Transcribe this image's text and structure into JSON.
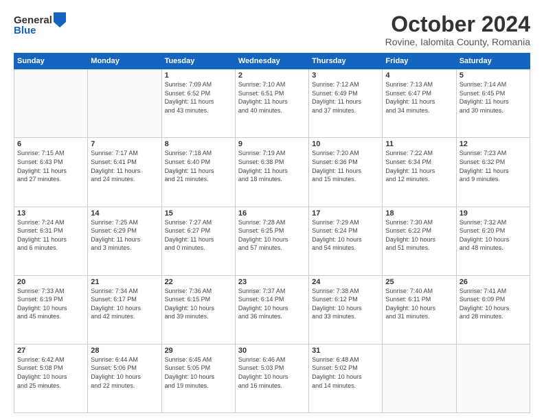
{
  "header": {
    "logo_general": "General",
    "logo_blue": "Blue",
    "title": "October 2024",
    "subtitle": "Rovine, Ialomita County, Romania"
  },
  "weekdays": [
    "Sunday",
    "Monday",
    "Tuesday",
    "Wednesday",
    "Thursday",
    "Friday",
    "Saturday"
  ],
  "weeks": [
    [
      {
        "day": "",
        "info": ""
      },
      {
        "day": "",
        "info": ""
      },
      {
        "day": "1",
        "info": "Sunrise: 7:09 AM\nSunset: 6:52 PM\nDaylight: 11 hours\nand 43 minutes."
      },
      {
        "day": "2",
        "info": "Sunrise: 7:10 AM\nSunset: 6:51 PM\nDaylight: 11 hours\nand 40 minutes."
      },
      {
        "day": "3",
        "info": "Sunrise: 7:12 AM\nSunset: 6:49 PM\nDaylight: 11 hours\nand 37 minutes."
      },
      {
        "day": "4",
        "info": "Sunrise: 7:13 AM\nSunset: 6:47 PM\nDaylight: 11 hours\nand 34 minutes."
      },
      {
        "day": "5",
        "info": "Sunrise: 7:14 AM\nSunset: 6:45 PM\nDaylight: 11 hours\nand 30 minutes."
      }
    ],
    [
      {
        "day": "6",
        "info": "Sunrise: 7:15 AM\nSunset: 6:43 PM\nDaylight: 11 hours\nand 27 minutes."
      },
      {
        "day": "7",
        "info": "Sunrise: 7:17 AM\nSunset: 6:41 PM\nDaylight: 11 hours\nand 24 minutes."
      },
      {
        "day": "8",
        "info": "Sunrise: 7:18 AM\nSunset: 6:40 PM\nDaylight: 11 hours\nand 21 minutes."
      },
      {
        "day": "9",
        "info": "Sunrise: 7:19 AM\nSunset: 6:38 PM\nDaylight: 11 hours\nand 18 minutes."
      },
      {
        "day": "10",
        "info": "Sunrise: 7:20 AM\nSunset: 6:36 PM\nDaylight: 11 hours\nand 15 minutes."
      },
      {
        "day": "11",
        "info": "Sunrise: 7:22 AM\nSunset: 6:34 PM\nDaylight: 11 hours\nand 12 minutes."
      },
      {
        "day": "12",
        "info": "Sunrise: 7:23 AM\nSunset: 6:32 PM\nDaylight: 11 hours\nand 9 minutes."
      }
    ],
    [
      {
        "day": "13",
        "info": "Sunrise: 7:24 AM\nSunset: 6:31 PM\nDaylight: 11 hours\nand 6 minutes."
      },
      {
        "day": "14",
        "info": "Sunrise: 7:25 AM\nSunset: 6:29 PM\nDaylight: 11 hours\nand 3 minutes."
      },
      {
        "day": "15",
        "info": "Sunrise: 7:27 AM\nSunset: 6:27 PM\nDaylight: 11 hours\nand 0 minutes."
      },
      {
        "day": "16",
        "info": "Sunrise: 7:28 AM\nSunset: 6:25 PM\nDaylight: 10 hours\nand 57 minutes."
      },
      {
        "day": "17",
        "info": "Sunrise: 7:29 AM\nSunset: 6:24 PM\nDaylight: 10 hours\nand 54 minutes."
      },
      {
        "day": "18",
        "info": "Sunrise: 7:30 AM\nSunset: 6:22 PM\nDaylight: 10 hours\nand 51 minutes."
      },
      {
        "day": "19",
        "info": "Sunrise: 7:32 AM\nSunset: 6:20 PM\nDaylight: 10 hours\nand 48 minutes."
      }
    ],
    [
      {
        "day": "20",
        "info": "Sunrise: 7:33 AM\nSunset: 6:19 PM\nDaylight: 10 hours\nand 45 minutes."
      },
      {
        "day": "21",
        "info": "Sunrise: 7:34 AM\nSunset: 6:17 PM\nDaylight: 10 hours\nand 42 minutes."
      },
      {
        "day": "22",
        "info": "Sunrise: 7:36 AM\nSunset: 6:15 PM\nDaylight: 10 hours\nand 39 minutes."
      },
      {
        "day": "23",
        "info": "Sunrise: 7:37 AM\nSunset: 6:14 PM\nDaylight: 10 hours\nand 36 minutes."
      },
      {
        "day": "24",
        "info": "Sunrise: 7:38 AM\nSunset: 6:12 PM\nDaylight: 10 hours\nand 33 minutes."
      },
      {
        "day": "25",
        "info": "Sunrise: 7:40 AM\nSunset: 6:11 PM\nDaylight: 10 hours\nand 31 minutes."
      },
      {
        "day": "26",
        "info": "Sunrise: 7:41 AM\nSunset: 6:09 PM\nDaylight: 10 hours\nand 28 minutes."
      }
    ],
    [
      {
        "day": "27",
        "info": "Sunrise: 6:42 AM\nSunset: 5:08 PM\nDaylight: 10 hours\nand 25 minutes."
      },
      {
        "day": "28",
        "info": "Sunrise: 6:44 AM\nSunset: 5:06 PM\nDaylight: 10 hours\nand 22 minutes."
      },
      {
        "day": "29",
        "info": "Sunrise: 6:45 AM\nSunset: 5:05 PM\nDaylight: 10 hours\nand 19 minutes."
      },
      {
        "day": "30",
        "info": "Sunrise: 6:46 AM\nSunset: 5:03 PM\nDaylight: 10 hours\nand 16 minutes."
      },
      {
        "day": "31",
        "info": "Sunrise: 6:48 AM\nSunset: 5:02 PM\nDaylight: 10 hours\nand 14 minutes."
      },
      {
        "day": "",
        "info": ""
      },
      {
        "day": "",
        "info": ""
      }
    ]
  ]
}
